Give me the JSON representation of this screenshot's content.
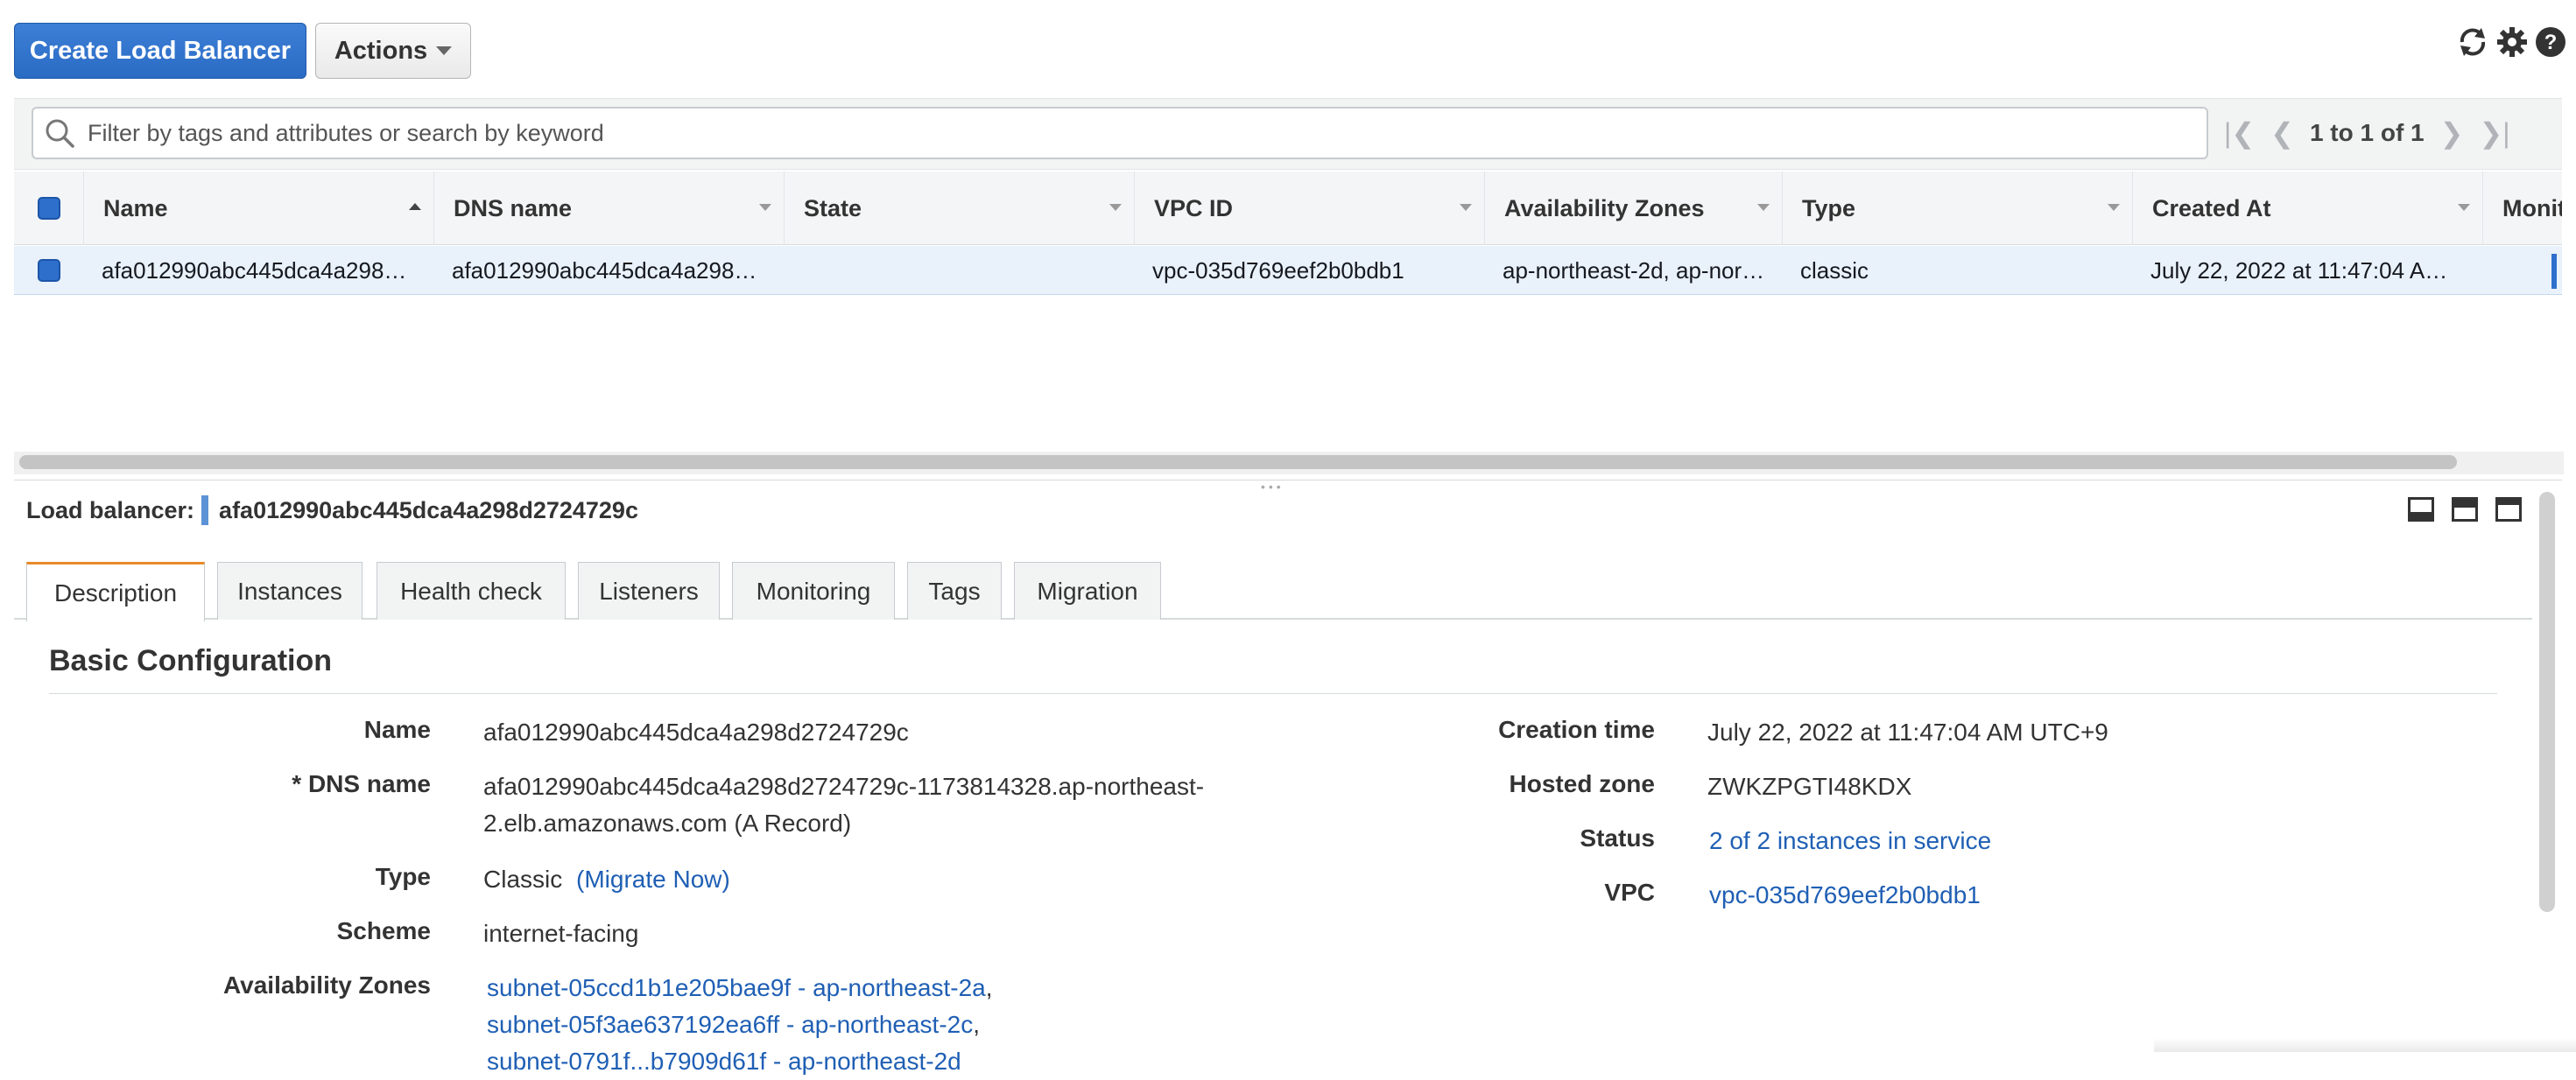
{
  "toolbar": {
    "create_label": "Create Load Balancer",
    "actions_label": "Actions",
    "icons": [
      "refresh-icon",
      "settings-gear-icon",
      "help-icon"
    ]
  },
  "filter": {
    "placeholder": "Filter by tags and attributes or search by keyword",
    "value": "",
    "pagination_text": "1 to 1 of 1"
  },
  "table": {
    "columns": [
      "Name",
      "DNS name",
      "State",
      "VPC ID",
      "Availability Zones",
      "Type",
      "Created At",
      "Monit"
    ],
    "sort_column": "Name",
    "rows": [
      {
        "selected": true,
        "cells": [
          "afa012990abc445dca4a298…",
          "afa012990abc445dca4a298…",
          "",
          "vpc-035d769eef2b0bdb1",
          "ap-northeast-2d, ap-nor…",
          "classic",
          "July 22, 2022 at 11:47:04 A…",
          ""
        ]
      }
    ]
  },
  "details": {
    "label": "Load balancer:",
    "lb_name": "afa012990abc445dca4a298d2724729c",
    "tabs": [
      "Description",
      "Instances",
      "Health check",
      "Listeners",
      "Monitoring",
      "Tags",
      "Migration"
    ],
    "active_tab": "Description",
    "section_title": "Basic Configuration",
    "left": {
      "name_label": "Name",
      "name_value": "afa012990abc445dca4a298d2724729c",
      "dns_label": "* DNS name",
      "dns_line1": "afa012990abc445dca4a298d2724729c-1173814328.ap-northeast-",
      "dns_line2": "2.elb.amazonaws.com (A Record)",
      "type_label": "Type",
      "type_value": "Classic",
      "migrate_link": "(Migrate Now)",
      "scheme_label": "Scheme",
      "scheme_value": "internet-facing",
      "az_label": "Availability Zones",
      "az_items": [
        "subnet-05ccd1b1e205bae9f - ap-northeast-2a",
        "subnet-05f3ae637192ea6ff - ap-northeast-2c",
        "subnet-0791f...b7909d61f - ap-northeast-2d"
      ]
    },
    "right": {
      "creation_label": "Creation time",
      "creation_value": "July 22, 2022 at 11:47:04 AM UTC+9",
      "hosted_label": "Hosted zone",
      "hosted_value": "ZWKZPGTI48KDX",
      "status_label": "Status",
      "status_value": "2 of 2 instances in service",
      "vpc_label": "VPC",
      "vpc_value": "vpc-035d769eef2b0bdb1"
    }
  },
  "colors": {
    "primary": "#2e6fcc",
    "link": "#1f5fb4",
    "active_tab_accent": "#e88a2b",
    "selected_row": "#e9f1fb"
  }
}
